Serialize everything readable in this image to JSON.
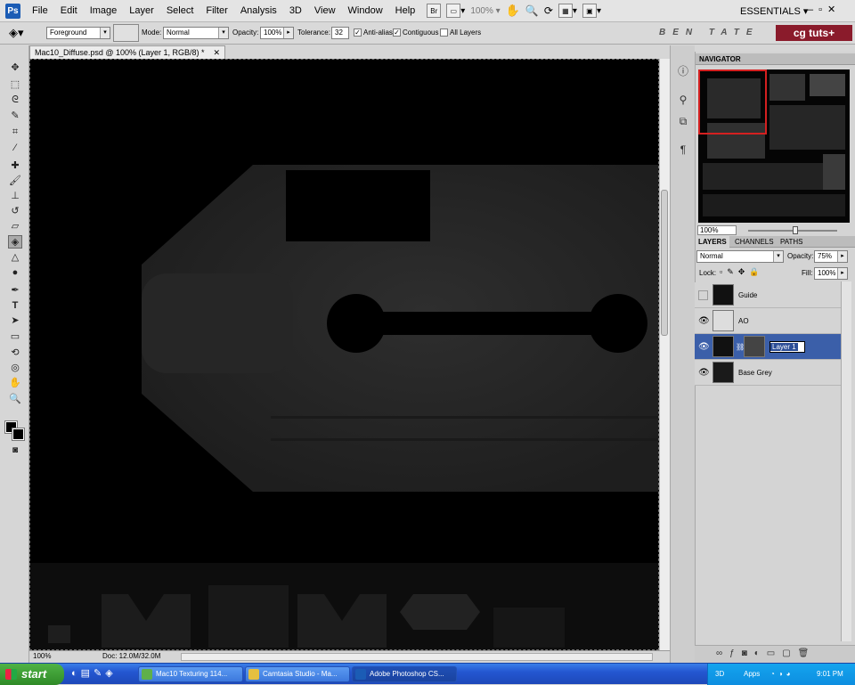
{
  "app": {
    "logo": "Ps"
  },
  "menu": [
    "File",
    "Edit",
    "Image",
    "Layer",
    "Select",
    "Filter",
    "Analysis",
    "3D",
    "View",
    "Window",
    "Help"
  ],
  "menubar_extra": {
    "bridge_label": "Br",
    "zoom": "100%",
    "workspace": "ESSENTIALS"
  },
  "options": {
    "fill_source": "Foreground",
    "mode_label": "Mode:",
    "mode_value": "Normal",
    "opacity_label": "Opacity:",
    "opacity_value": "100%",
    "tolerance_label": "Tolerance:",
    "tolerance_value": "32",
    "anti_alias": "Anti-alias",
    "contiguous": "Contiguous",
    "all_layers": "All Layers"
  },
  "brand": {
    "name": "BEN TATE",
    "site": "cg tuts+"
  },
  "document": {
    "tab_title": "Mac10_Diffuse.psd @ 100% (Layer 1, RGB/8) *",
    "zoom": "100%",
    "doc_size": "Doc: 12.0M/32.0M"
  },
  "navigator": {
    "title": "NAVIGATOR",
    "zoom": "100%"
  },
  "layers_panel": {
    "tabs": [
      "LAYERS",
      "CHANNELS",
      "PATHS"
    ],
    "blend_mode": "Normal",
    "opacity_label": "Opacity:",
    "opacity_value": "75%",
    "lock_label": "Lock:",
    "fill_label": "Fill:",
    "fill_value": "100%",
    "layers": [
      {
        "name": "Guide",
        "visible": false
      },
      {
        "name": "AO",
        "visible": true
      },
      {
        "name": "Layer 1",
        "visible": true,
        "selected": true
      },
      {
        "name": "Base Grey",
        "visible": true
      }
    ]
  },
  "taskbar": {
    "start": "start",
    "tasks": [
      "Mac10 Texturing 114...",
      "Camtasia Studio - Ma...",
      "Adobe Photoshop CS..."
    ],
    "tray_3d": "3D",
    "tray_apps": "Apps",
    "clock": "9:01 PM"
  },
  "colors": {
    "foreground": "#000000",
    "background": "#000000",
    "selection": "#3b5fa9"
  }
}
